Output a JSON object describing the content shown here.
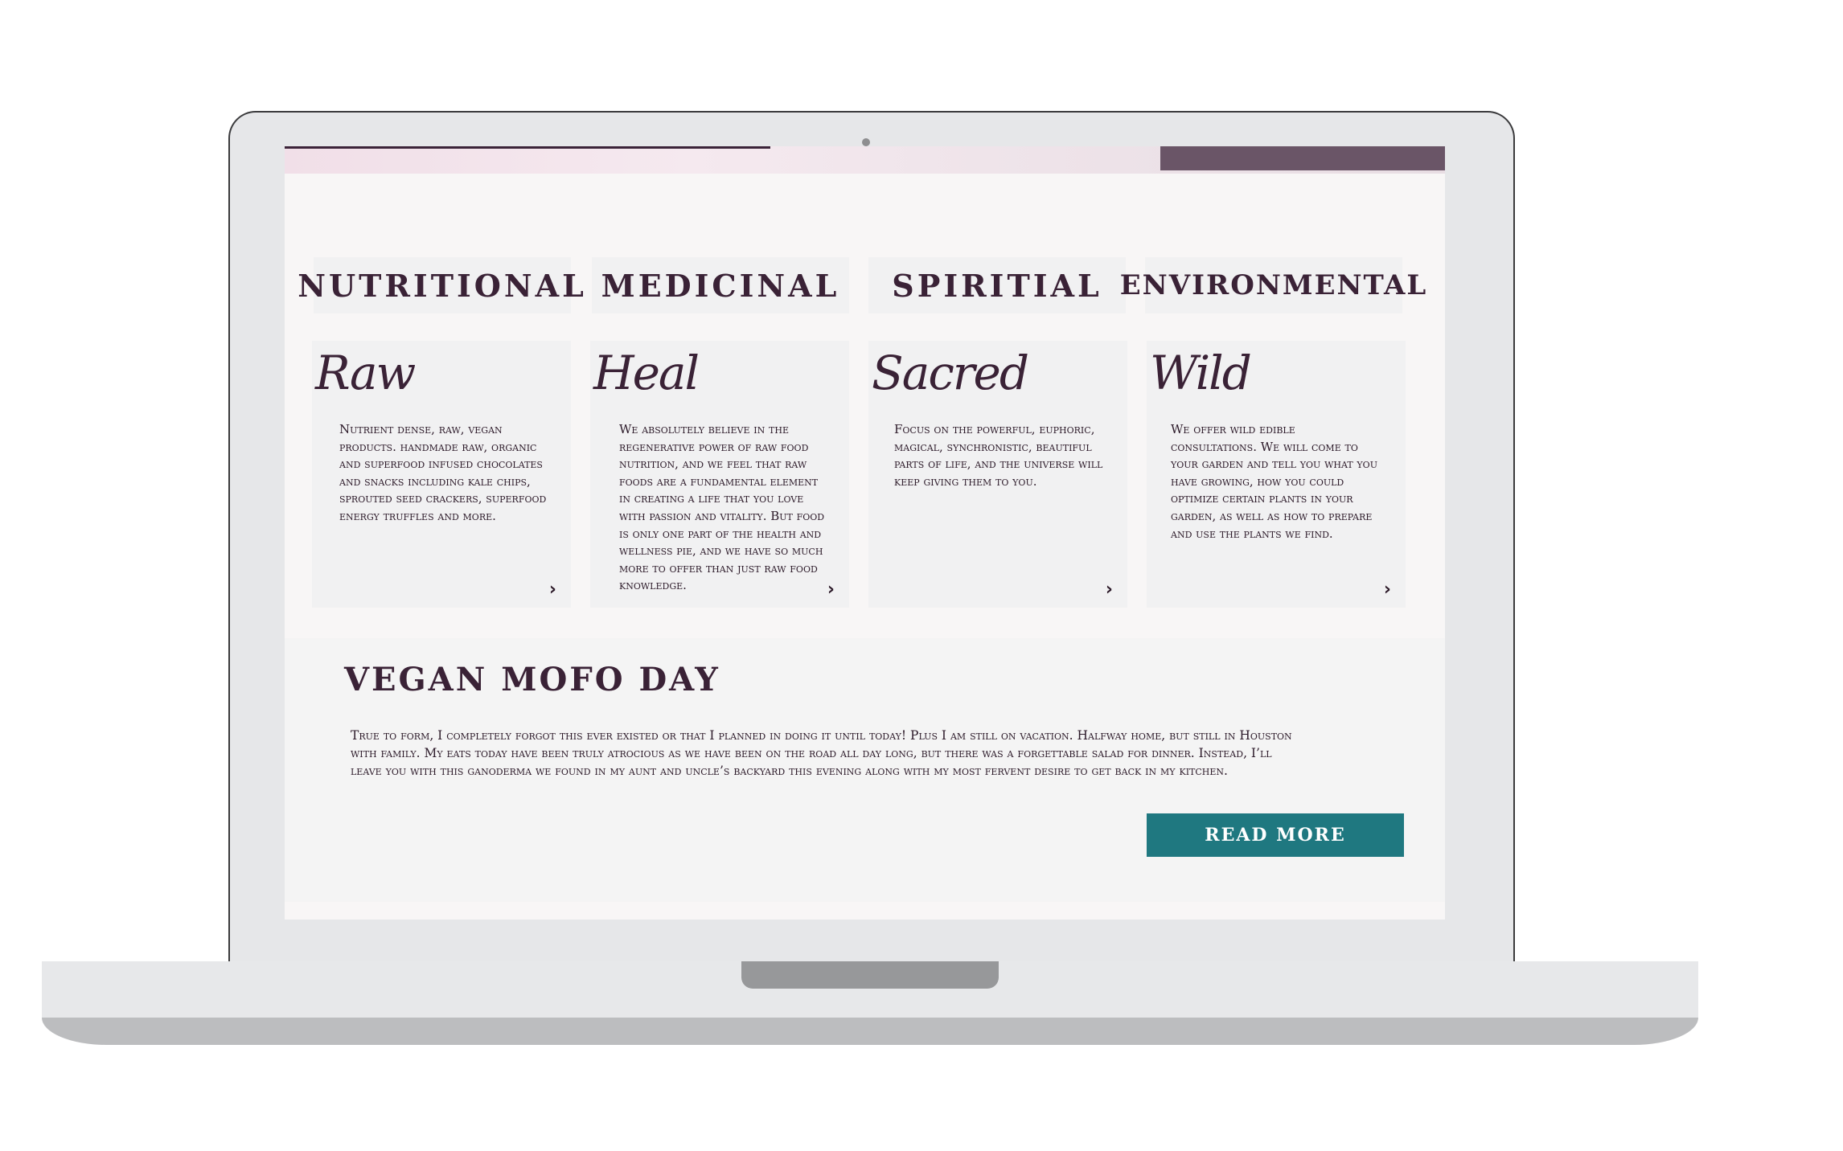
{
  "categories": [
    {
      "label": "NUTRITIONAL",
      "script": "Raw",
      "text": "Nutrient dense, raw, vegan products. handmade raw, organic and superfood infused chocolates and snacks including kale chips, sprouted seed crackers, superfood energy truffles and more.",
      "arrow": "›"
    },
    {
      "label": "MEDICINAL",
      "script": "Heal",
      "text": "We absolutely believe in the regenerative power of raw food nutrition, and we feel that raw foods are a fundamental element in creating a life that you love with passion and vitality.  But food is only one part of the health and wellness pie, and we have so much more to offer than just raw food knowledge.",
      "arrow": "›"
    },
    {
      "label": "SPIRITIAL",
      "script": "Sacred",
      "text": "Focus on the powerful, euphoric, magical, synchronistic, beautiful parts of life, and the universe will keep giving them to you.",
      "arrow": "›"
    },
    {
      "label": "ENVIRONMENTAL",
      "script": "Wild",
      "text": "We offer wild edible consultations.  We will come to your garden and tell you what you have growing, how you could optimize certain plants in your garden, as well as how to prepare and use the plants we find.",
      "arrow": "›"
    }
  ],
  "blog": {
    "title": "VEGAN MOFO DAY",
    "text": "True to form, I completely forgot this ever existed or that I planned in doing it until today! Plus I am still on vacation. Halfway home, but still in Houston with family. My eats today have been truly atrocious as we have been on the road all day long, but there was a forgettable salad for dinner. Instead, I’ll leave you with this ganoderma we found in my aunt and uncle’s backyard this evening along with my most fervent desire to get back in my kitchen.",
    "button": "READ MORE"
  },
  "colors": {
    "accent": "#1f7880",
    "text": "#3a2236",
    "card_bg": "#f1f1f2"
  }
}
